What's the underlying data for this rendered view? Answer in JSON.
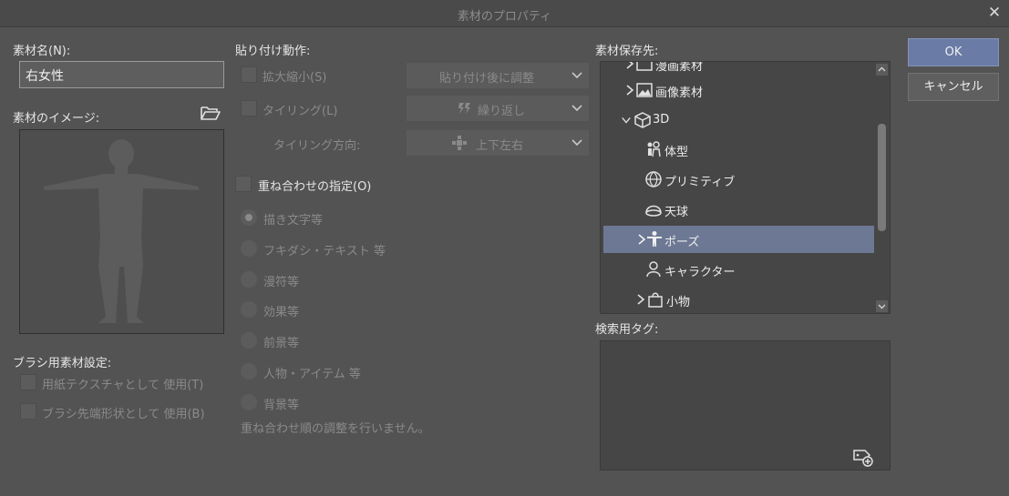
{
  "window": {
    "title": "素材のプロパティ"
  },
  "left": {
    "name_label": "素材名(N):",
    "name_value": "右女性",
    "image_label": "素材のイメージ:",
    "brush_section_label": "ブラシ用素材設定:",
    "brush_options": [
      {
        "label": "用紙テクスチャとして 使用(T)"
      },
      {
        "label": "ブラシ先端形状として 使用(B)"
      }
    ]
  },
  "paste": {
    "section_label": "貼り付け動作:",
    "scale_label": "拡大縮小(S)",
    "scale_select": "貼り付け後に調整",
    "tiling_label": "タイリング(L)",
    "tiling_select": "繰り返し",
    "tiling_dir_label": "タイリング方向:",
    "tiling_dir_select": "上下左右",
    "overlay_label": "重ね合わせの指定(O)",
    "overlay_options": [
      {
        "label": "描き文字等"
      },
      {
        "label": "フキダシ・テキスト 等"
      },
      {
        "label": "漫符等"
      },
      {
        "label": "効果等"
      },
      {
        "label": "前景等"
      },
      {
        "label": "人物・アイテム 等"
      },
      {
        "label": "背景等"
      }
    ],
    "note": "重ね合わせ順の調整を行いません。"
  },
  "save": {
    "section_label": "素材保存先:",
    "tree": [
      {
        "label": "漫画素材",
        "icon": "folder-icon"
      },
      {
        "label": "画像素材",
        "icon": "image-icon"
      },
      {
        "label": "3D",
        "icon": "cube-icon"
      },
      {
        "label": "体型",
        "icon": "body-type-icon"
      },
      {
        "label": "プリミティブ",
        "icon": "globe-icon"
      },
      {
        "label": "天球",
        "icon": "sky-dome-icon"
      },
      {
        "label": "ポーズ",
        "icon": "pose-icon"
      },
      {
        "label": "キャラクター",
        "icon": "character-icon"
      },
      {
        "label": "小物",
        "icon": "bag-icon"
      }
    ],
    "tag_label": "検索用タグ:"
  },
  "buttons": {
    "ok": "OK",
    "cancel": "キャンセル"
  },
  "colors": {
    "accent": "#6a7ba5",
    "selection": "#6d7894",
    "background": "#535353"
  }
}
